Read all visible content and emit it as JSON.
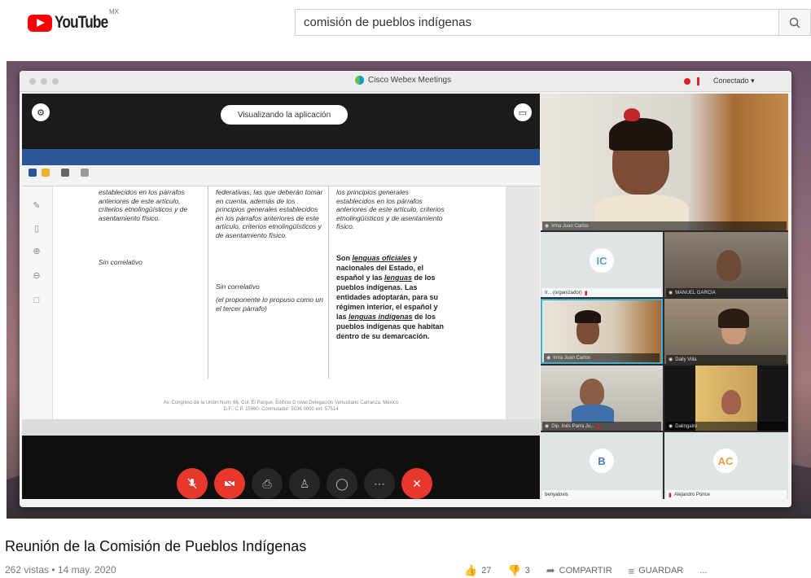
{
  "youtube": {
    "logo_text": "YouTube",
    "region": "MX",
    "search_value": "comisión de pueblos indígenas",
    "search_icon": "search-icon"
  },
  "webex": {
    "window_title": "Cisco Webex Meetings",
    "status": "Conectado ▾",
    "share_pill": "Visualizando la aplicación"
  },
  "document": {
    "col1_top": "establecidos en los párrafos anteriores de este artículo, criterios etnolingüísticos y de asentamiento físico.",
    "col1_mid": "Sin correlativo",
    "col2_top": "federativas, las que deberán tomar en cuenta, además de los principios generales establecidos en los párrafos anteriores de este artículo, criterios etnolingüísticos y de asentamiento físico.",
    "col2_mid_a": "Sin correlativo",
    "col2_mid_b": "(el proponente lo propuso como un el tercer párrafo)",
    "col3_top": "los principios generales establecidos en los párrafos anteriores de este artículo, criterios etnolingüísticos y de asentamiento físico.",
    "col3_bold_a": "Son ",
    "col3_bold_u1": "lenguas oficiales",
    "col3_bold_b": " y nacionales del Estado, el español y las ",
    "col3_bold_u2": "lenguas",
    "col3_bold_c": " de los pueblos indígenas. Las entidades adoptarán, para su régimen interior, el español y las ",
    "col3_bold_u3": "lenguas indígenas",
    "col3_bold_d": " de los pueblos indígenas que habitan dentro de su demarcación.",
    "footer": "Av. Congreso de la Unión Núm. 66, Col. El Parque, Edificio D nivel Delegación Venustiano Carranza, México D.F., C.P. 15960. Conmutador: 5036 0000 ext. 57514"
  },
  "participants": {
    "main_speaker": "Irma Juan Carlos",
    "tiles": [
      {
        "initials": "IC",
        "label": "Ir... (organizador)"
      },
      {
        "label": "MANUEL GARCIA"
      },
      {
        "label": "Irma Juan Carlos"
      },
      {
        "label": "Daily Vilia"
      },
      {
        "label": "Dip. Inés Parra Ju..."
      },
      {
        "label": "Dalingairo"
      },
      {
        "initials": "B",
        "label": "benyatovis"
      },
      {
        "initials": "AC",
        "label": "Alejandro Ponce"
      }
    ]
  },
  "video": {
    "title": "Reunión de la Comisión de Pueblos Indígenas",
    "meta": "262 vistas • 14 may. 2020",
    "likes": "27",
    "dislikes": "3",
    "share_label": "COMPARTIR",
    "save_label": "GUARDAR",
    "more": "..."
  },
  "colors": {
    "youtube_red": "#ff0000",
    "webex_red": "#e8372c",
    "word_blue": "#2b579a"
  }
}
